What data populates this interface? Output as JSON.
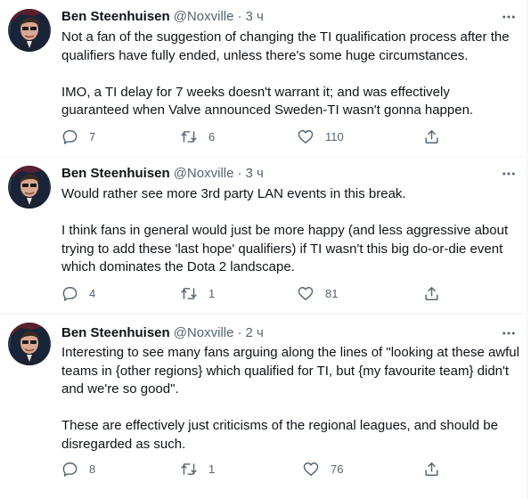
{
  "tweets": [
    {
      "author_name": "Ben Steenhuisen",
      "handle": "@Noxville",
      "separator": "·",
      "time": "3 ч",
      "paragraphs": [
        "Not a fan of the suggestion of changing the TI qualification process after the qualifiers have fully ended, unless there's some huge circumstances.",
        "IMO, a TI delay for 7 weeks doesn't warrant it; and was effectively guaranteed when Valve announced Sweden-TI wasn't gonna happen."
      ],
      "replies": "7",
      "retweets": "6",
      "likes": "110"
    },
    {
      "author_name": "Ben Steenhuisen",
      "handle": "@Noxville",
      "separator": "·",
      "time": "3 ч",
      "paragraphs": [
        "Would rather see more 3rd party LAN events in this break.",
        "I think fans in general would just be more happy (and less aggressive about trying to add these 'last hope' qualifiers) if TI wasn't this big do-or-die event which dominates the Dota 2 landscape."
      ],
      "replies": "4",
      "retweets": "1",
      "likes": "81"
    },
    {
      "author_name": "Ben Steenhuisen",
      "handle": "@Noxville",
      "separator": "·",
      "time": "2 ч",
      "paragraphs": [
        "Interesting to see many fans arguing along the lines of \"looking at these awful teams in {other regions} which qualified for TI, but {my favourite team} didn't and we're so good\".",
        "These are effectively just criticisms of the regional leagues, and should be disregarded as such."
      ],
      "replies": "8",
      "retweets": "1",
      "likes": "76"
    }
  ],
  "icons": {
    "reply": "reply-icon",
    "retweet": "retweet-icon",
    "like": "heart-icon",
    "share": "share-icon",
    "more": "more-icon"
  },
  "colors": {
    "text": "#0f1419",
    "secondary": "#536471",
    "divider": "#eff3f4"
  }
}
